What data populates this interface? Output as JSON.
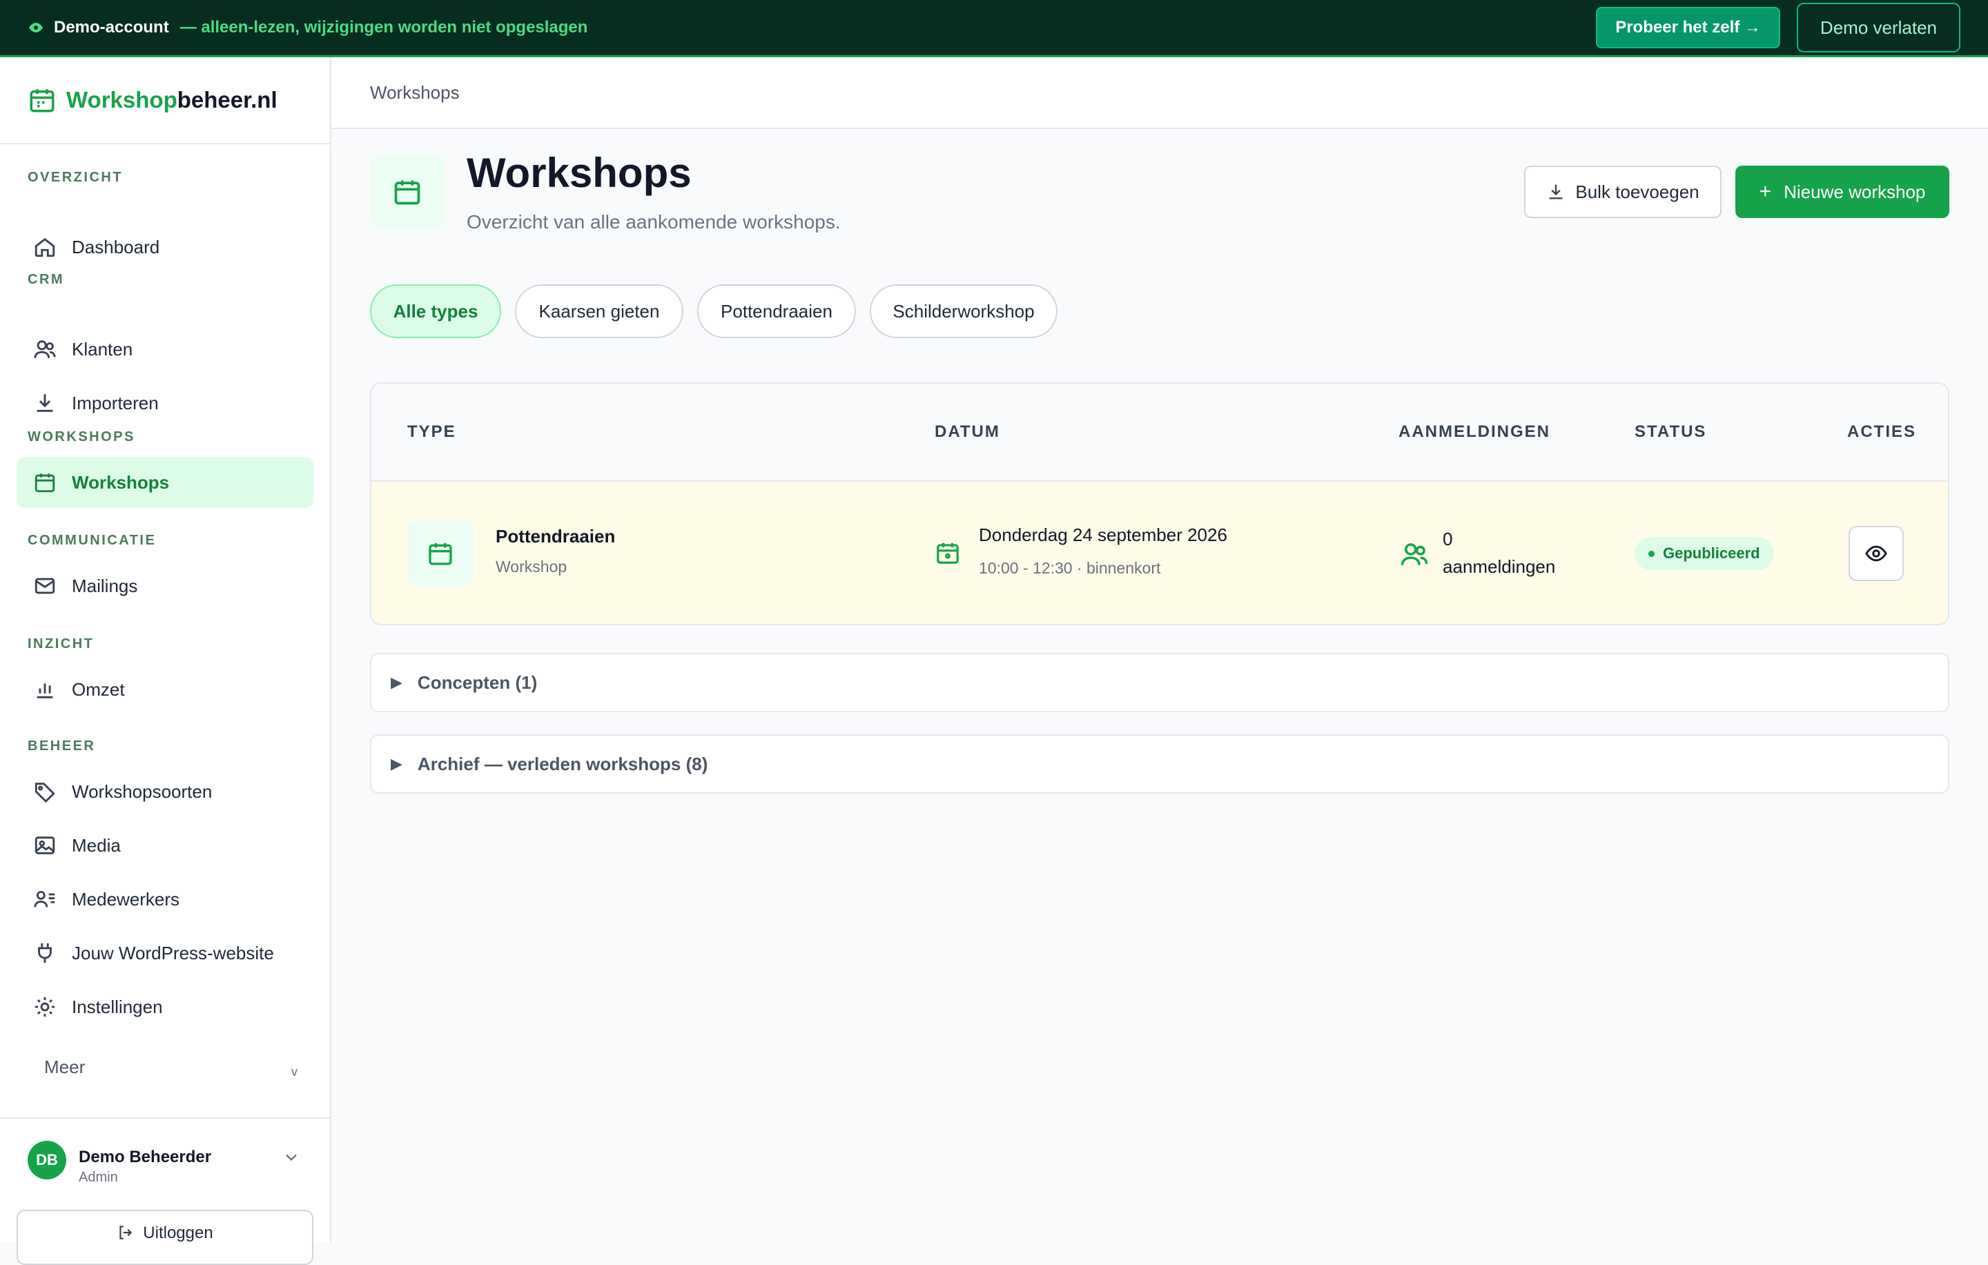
{
  "banner": {
    "title": "Demo-account",
    "subtitle": "— alleen-lezen, wijzigingen worden niet opgeslagen",
    "try_button": "Probeer het zelf →",
    "leave_button": "Demo verlaten"
  },
  "brand": {
    "part1": "Workshop",
    "part2": "beheer.nl"
  },
  "sidebar": {
    "sections": {
      "overzicht": "OVERZICHT",
      "crm": "CRM",
      "workshops": "WORKSHOPS",
      "communicatie": "COMMUNICATIE",
      "inzicht": "INZICHT",
      "beheer": "BEHEER"
    },
    "items": {
      "dashboard": "Dashboard",
      "klanten": "Klanten",
      "importeren": "Importeren",
      "workshops": "Workshops",
      "mailings": "Mailings",
      "omzet": "Omzet",
      "workshopsoorten": "Workshopsoorten",
      "media": "Media",
      "medewerkers": "Medewerkers",
      "wordpress": "Jouw WordPress-website",
      "instellingen": "Instellingen"
    },
    "more": "Meer",
    "more_chevron": "v",
    "user": {
      "initials": "DB",
      "name": "Demo Beheerder",
      "role": "Admin"
    },
    "logout": "Uitloggen"
  },
  "breadcrumb": "Workshops",
  "page": {
    "title": "Workshops",
    "subtitle": "Overzicht van alle aankomende workshops.",
    "bulk_button": "Bulk toevoegen",
    "new_button": "Nieuwe workshop",
    "new_plus": "+"
  },
  "filters": [
    "Alle types",
    "Kaarsen gieten",
    "Pottendraaien",
    "Schilderworkshop"
  ],
  "table": {
    "headers": {
      "type": "TYPE",
      "datum": "DATUM",
      "aanmeldingen": "AANMELDINGEN",
      "status": "STATUS",
      "acties": "ACTIES"
    },
    "rows": [
      {
        "name": "Pottendraaien",
        "kind": "Workshop",
        "date": "Donderdag 24 september 2026",
        "time": "10:00 - 12:30 · binnenkort",
        "count": "0",
        "count_label": "aanmeldingen",
        "status": "Gepubliceerd"
      }
    ]
  },
  "collapsibles": {
    "concepten": "Concepten (1)",
    "archief": "Archief — verleden workshops (8)",
    "arrow": "▶"
  },
  "colors": {
    "accent": "#16a34a",
    "banner_bg": "#062d1f",
    "row_highlight": "#fefce8"
  }
}
